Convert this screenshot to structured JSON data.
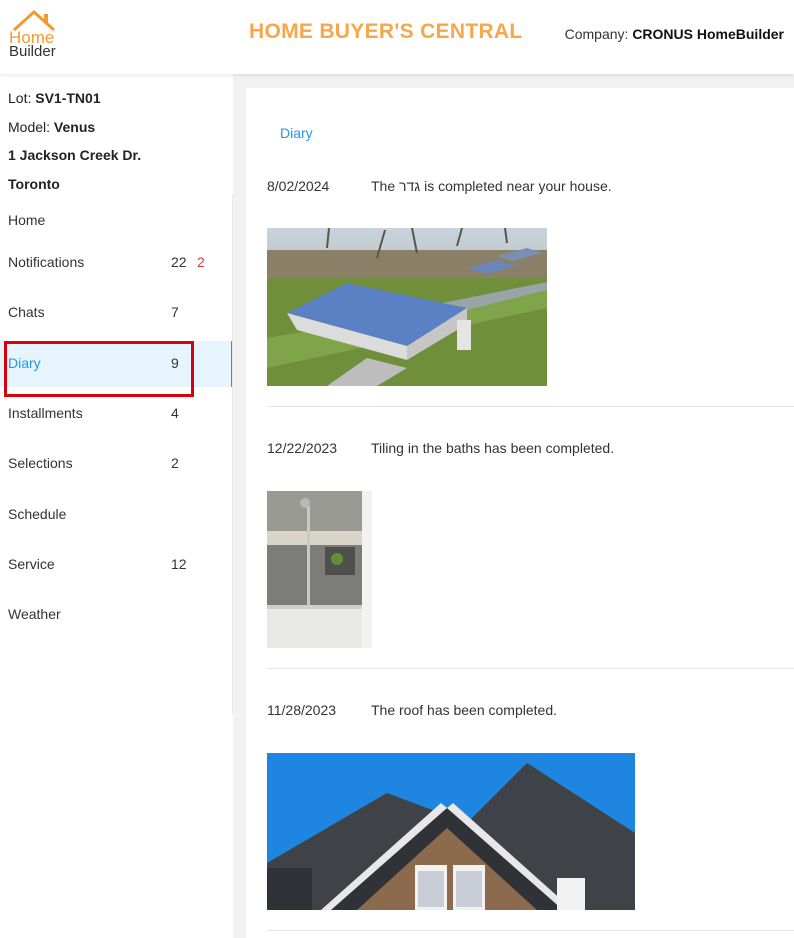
{
  "header": {
    "logo_line1": "Home",
    "logo_line2": "Builder",
    "title": "HOME BUYER'S CENTRAL",
    "company_label": "Company:",
    "company_name": "CRONUS HomeBuilder"
  },
  "lot": {
    "lot_label": "Lot:",
    "lot_value": "SV1-TN01",
    "model_label": "Model:",
    "model_value": "Venus",
    "address": "1 Jackson Creek Dr.",
    "city": "Toronto"
  },
  "nav": [
    {
      "label": "Home",
      "count": ""
    },
    {
      "label": "Notifications",
      "count": "22",
      "count2": "2"
    },
    {
      "label": "Chats",
      "count": "7"
    },
    {
      "label": "Diary",
      "count": "9"
    },
    {
      "label": "Installments",
      "count": "4"
    },
    {
      "label": "Selections",
      "count": "2"
    },
    {
      "label": "Schedule",
      "count": ""
    },
    {
      "label": "Service",
      "count": "12"
    },
    {
      "label": "Weather",
      "count": ""
    }
  ],
  "main": {
    "section_title": "Diary",
    "entries": [
      {
        "date": "8/02/2024",
        "text": "The גדר is completed near your house.",
        "image": "aerial-house-photo"
      },
      {
        "date": "12/22/2023",
        "text": "Tiling in the baths has been completed.",
        "image": "bathroom-tile-photo"
      },
      {
        "date": "11/28/2023",
        "text": "The roof has been completed.",
        "image": "roof-photo"
      }
    ]
  },
  "colors": {
    "brand_orange": "#f7a64a",
    "accent_blue": "#2196f3",
    "active_bg": "#e6f4fd",
    "badge_red": "#e53935",
    "highlight_red": "#d9000d"
  }
}
